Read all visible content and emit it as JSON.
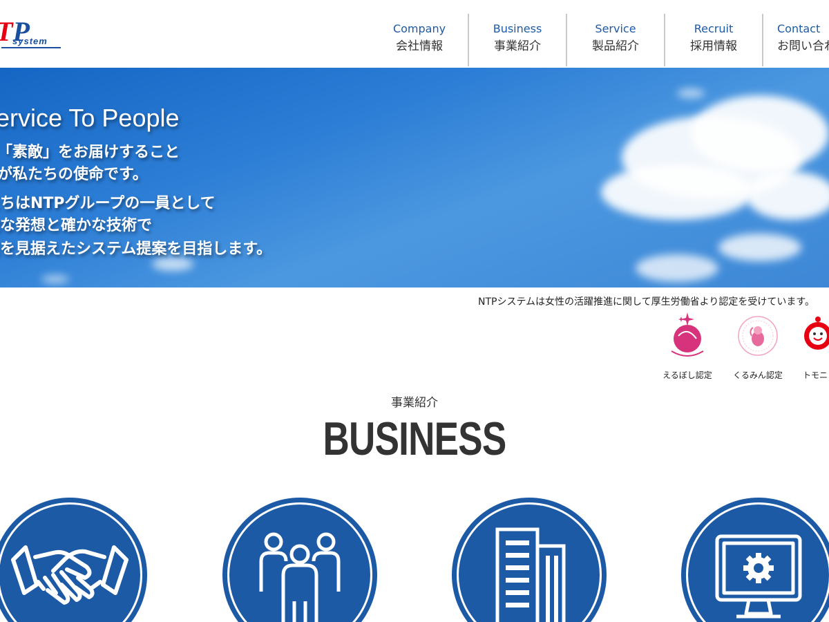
{
  "header": {
    "logo_text": "NTP system",
    "nav": [
      {
        "en": "Company",
        "ja": "会社情報"
      },
      {
        "en": "Business",
        "ja": "事業紹介"
      },
      {
        "en": "Service",
        "ja": "製品紹介"
      },
      {
        "en": "Recruit",
        "ja": "採用情報"
      },
      {
        "en": "Contact",
        "ja": "お問い合わせ"
      }
    ]
  },
  "hero": {
    "title": "Service To People",
    "lines": [
      "人々に「素敵」をお届けすること",
      "それが私たちの使命です。",
      "私たちはNTPグループの一員として",
      "柔軟な発想と確かな技術で",
      "未来を見据えたシステム提案を目指します。"
    ]
  },
  "certification": {
    "text": "NTPシステムは女性の活躍推進に関して厚生労働省より認定を受けています。",
    "items": [
      {
        "label": "えるぼし認定",
        "icon": "eruboshi-icon"
      },
      {
        "label": "くるみん認定",
        "icon": "kurumin-icon"
      },
      {
        "label": "トモニン",
        "icon": "tomonin-icon"
      }
    ]
  },
  "business": {
    "subtitle": "事業紹介",
    "title": "BUSINESS",
    "icons": [
      "handshake-icon",
      "people-icon",
      "building-icon",
      "monitor-gear-icon"
    ]
  },
  "colors": {
    "brand_blue": "#1c5aa5",
    "nav_blue": "#1d5aa6",
    "logo_red": "#e60012"
  }
}
